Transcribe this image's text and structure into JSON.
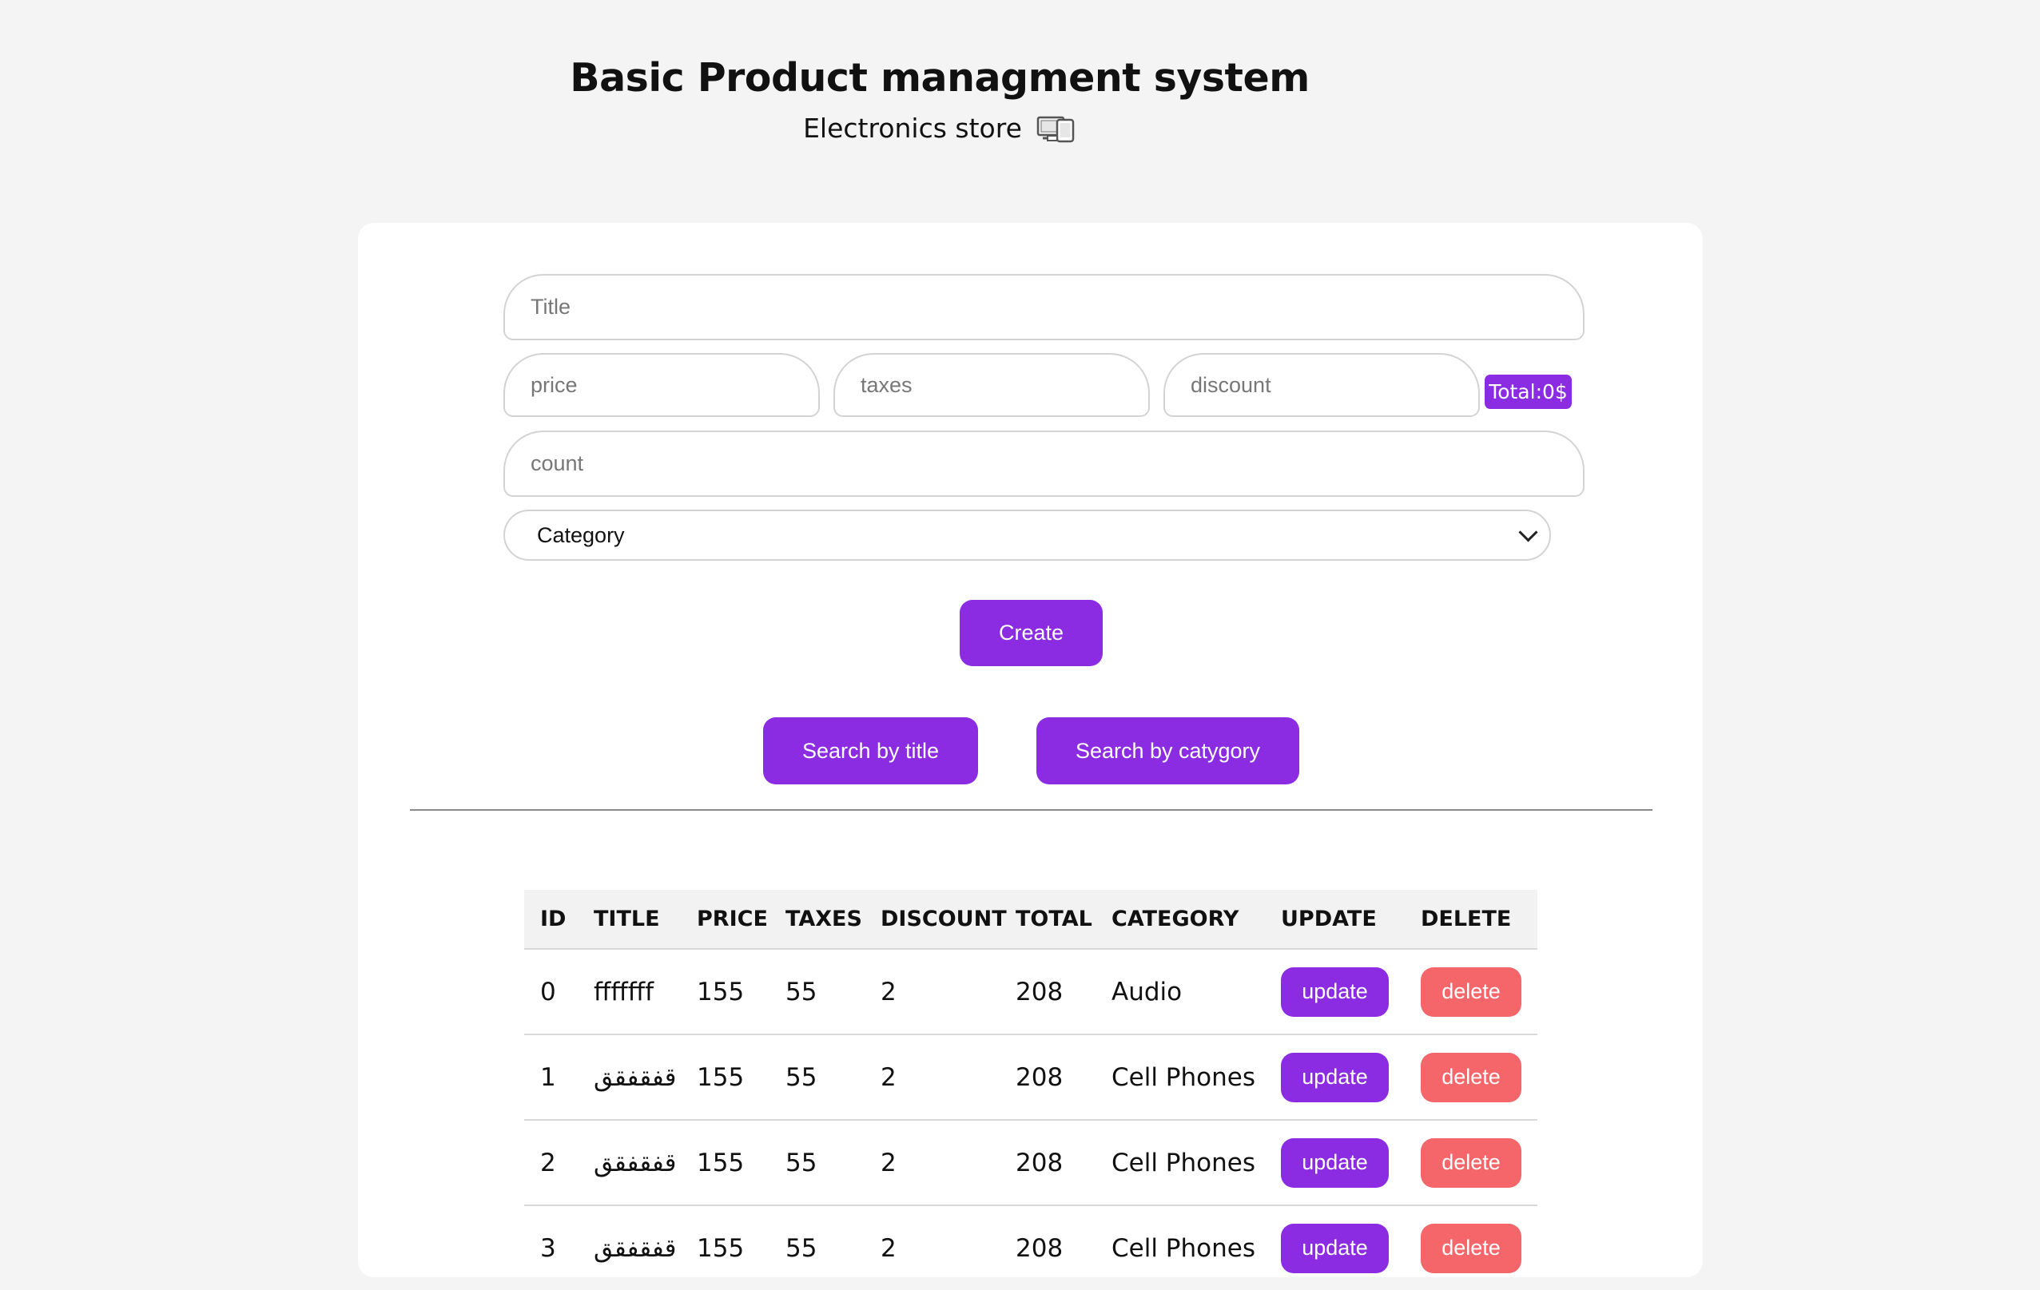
{
  "header": {
    "title": "Basic Product managment system",
    "subtitle": "Electronics store",
    "icon": "devices-icon"
  },
  "form": {
    "title_placeholder": "Title",
    "price_placeholder": "price",
    "taxes_placeholder": "taxes",
    "discount_placeholder": "discount",
    "total_label": "Total:0$",
    "count_placeholder": "count",
    "category_selected": "Category",
    "create_label": "Create"
  },
  "search": {
    "by_title_label": "Search by title",
    "by_category_label": "Search by catygory"
  },
  "colors": {
    "accent": "#8b2be2",
    "danger": "#f4666a",
    "background": "#f4f4f4"
  },
  "table": {
    "headers": [
      "ID",
      "TITLE",
      "PRICE",
      "TAXES",
      "DISCOUNT",
      "TOTAL",
      "CATEGORY",
      "UPDATE",
      "DELETE"
    ],
    "update_label": "update",
    "delete_label": "delete",
    "rows": [
      {
        "id": "0",
        "title": "fffffff",
        "price": "155",
        "taxes": "55",
        "discount": "2",
        "total": "208",
        "category": "Audio"
      },
      {
        "id": "1",
        "title": "قفقفقق",
        "price": "155",
        "taxes": "55",
        "discount": "2",
        "total": "208",
        "category": "Cell Phones"
      },
      {
        "id": "2",
        "title": "قفقفقق",
        "price": "155",
        "taxes": "55",
        "discount": "2",
        "total": "208",
        "category": "Cell Phones"
      },
      {
        "id": "3",
        "title": "قفقفقق",
        "price": "155",
        "taxes": "55",
        "discount": "2",
        "total": "208",
        "category": "Cell Phones"
      }
    ]
  }
}
